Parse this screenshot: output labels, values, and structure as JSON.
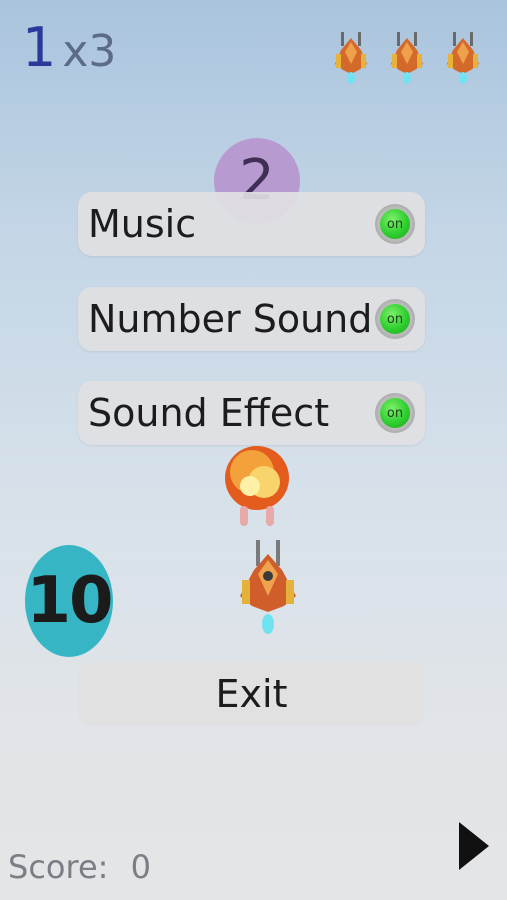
{
  "hud": {
    "level_number": "1",
    "multiplier": "x3",
    "lives_count": 3
  },
  "purple_circle_text": "2",
  "settings": [
    {
      "label": "Music",
      "toggle": "on"
    },
    {
      "label": "Number Sound",
      "toggle": "on"
    },
    {
      "label": "Sound Effect",
      "toggle": "on"
    }
  ],
  "number_circle": "10",
  "exit_label": "Exit",
  "score": {
    "label": "Score:",
    "value": "0"
  },
  "icons": {
    "life": "ship-icon",
    "play": "play-arrow-icon",
    "toggle": "toggle-icon"
  },
  "colors": {
    "level_number": "#2b3a9a",
    "multiplier": "#5c6b86",
    "purple_circle": "#b79bd0",
    "number_circle": "#36b6c4",
    "toggle_on": "#2fcf2f",
    "score_text": "#7a7f86"
  }
}
